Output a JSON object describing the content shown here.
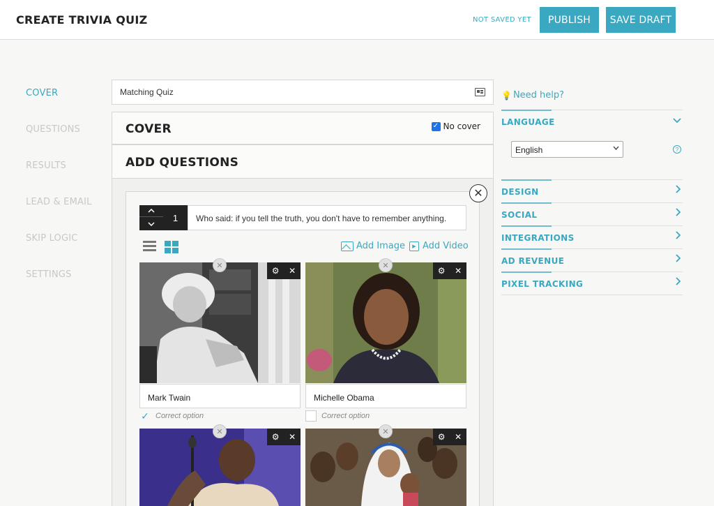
{
  "header": {
    "title": "CREATE TRIVIA QUIZ",
    "status": "NOT SAVED YET",
    "publish_label": "PUBLISH",
    "save_draft_label": "SAVE DRAFT",
    "accent_color": "#3aa8c1"
  },
  "nav": {
    "items": [
      {
        "label": "COVER",
        "active": true
      },
      {
        "label": "QUESTIONS",
        "active": false
      },
      {
        "label": "RESULTS",
        "active": false
      },
      {
        "label": "LEAD & EMAIL",
        "active": false
      },
      {
        "label": "SKIP LOGIC",
        "active": false
      },
      {
        "label": "SETTINGS",
        "active": false
      }
    ]
  },
  "quiz": {
    "title_value": "Matching Quiz",
    "cover": {
      "heading": "COVER",
      "no_cover_label": "No cover",
      "no_cover_checked": true
    },
    "questions_heading": "ADD QUESTIONS",
    "question": {
      "number": "1",
      "text": "Who said: if you tell the truth, you don't have to remember anything.",
      "add_image_label": "Add Image",
      "add_video_label": "Add Video",
      "correct_option_label": "Correct option",
      "answers": [
        {
          "label": "Mark Twain",
          "correct": true
        },
        {
          "label": "Michelle Obama",
          "correct": false
        },
        {
          "label": "",
          "correct": false
        },
        {
          "label": "",
          "correct": false
        }
      ]
    }
  },
  "sidebar": {
    "help_label": "Need help?",
    "language": {
      "label": "LANGUAGE",
      "selected": "English",
      "help_glyph": "?"
    },
    "sections": [
      {
        "label": "DESIGN"
      },
      {
        "label": "SOCIAL"
      },
      {
        "label": "INTEGRATIONS"
      },
      {
        "label": "AD REVENUE"
      },
      {
        "label": "PIXEL TRACKING"
      }
    ]
  },
  "icons": {
    "up": "chevron-up-icon",
    "down": "chevron-down-icon",
    "close": "close-icon",
    "gear": "gear-icon",
    "check": "checkmark-icon",
    "list": "list-view-icon",
    "grid": "grid-view-icon",
    "image": "image-icon",
    "video": "video-icon",
    "bulb": "lightbulb-icon",
    "card": "id-card-icon"
  }
}
